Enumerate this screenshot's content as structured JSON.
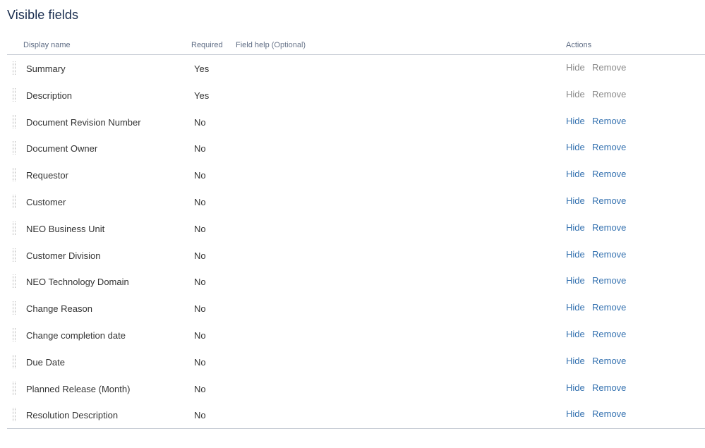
{
  "title": "Visible fields",
  "columns": {
    "display_name": "Display name",
    "required": "Required",
    "field_help": "Field help",
    "field_help_optional": "(Optional)",
    "actions": "Actions"
  },
  "colors": {
    "link": "#3572b0",
    "disabled_link": "#8a8a8a",
    "title": "#172b4d",
    "header_text": "#5e6c84",
    "divider": "#c1c7d0"
  },
  "rows": [
    {
      "name": "Summary",
      "required": "Yes",
      "hide": "Hide",
      "remove": "Remove",
      "actions_enabled": false
    },
    {
      "name": "Description",
      "required": "Yes",
      "hide": "Hide",
      "remove": "Remove",
      "actions_enabled": false
    },
    {
      "name": "Document Revision Number",
      "required": "No",
      "hide": "Hide",
      "remove": "Remove",
      "actions_enabled": true
    },
    {
      "name": "Document Owner",
      "required": "No",
      "hide": "Hide",
      "remove": "Remove",
      "actions_enabled": true
    },
    {
      "name": "Requestor",
      "required": "No",
      "hide": "Hide",
      "remove": "Remove",
      "actions_enabled": true
    },
    {
      "name": "Customer",
      "required": "No",
      "hide": "Hide",
      "remove": "Remove",
      "actions_enabled": true
    },
    {
      "name": "NEO Business Unit",
      "required": "No",
      "hide": "Hide",
      "remove": "Remove",
      "actions_enabled": true
    },
    {
      "name": "Customer Division",
      "required": "No",
      "hide": "Hide",
      "remove": "Remove",
      "actions_enabled": true
    },
    {
      "name": "NEO Technology Domain",
      "required": "No",
      "hide": "Hide",
      "remove": "Remove",
      "actions_enabled": true
    },
    {
      "name": "Change Reason",
      "required": "No",
      "hide": "Hide",
      "remove": "Remove",
      "actions_enabled": true
    },
    {
      "name": "Change completion date",
      "required": "No",
      "hide": "Hide",
      "remove": "Remove",
      "actions_enabled": true
    },
    {
      "name": "Due Date",
      "required": "No",
      "hide": "Hide",
      "remove": "Remove",
      "actions_enabled": true
    },
    {
      "name": "Planned Release (Month)",
      "required": "No",
      "hide": "Hide",
      "remove": "Remove",
      "actions_enabled": true
    },
    {
      "name": "Resolution Description",
      "required": "No",
      "hide": "Hide",
      "remove": "Remove",
      "actions_enabled": true
    }
  ],
  "icons": {
    "drag_handle": "drag-handle-icon"
  }
}
